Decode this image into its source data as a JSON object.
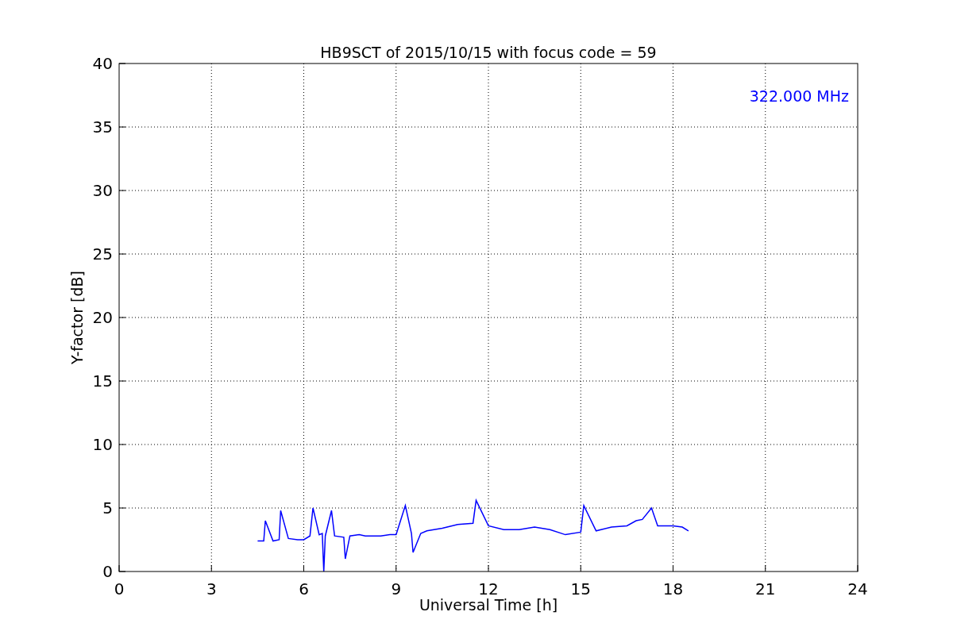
{
  "chart_data": {
    "type": "line",
    "title": "HB9SCT of 2015/10/15 with focus code = 59",
    "xlabel": "Universal Time [h]",
    "ylabel": "Y-factor [dB]",
    "x": [
      4.5,
      4.7,
      4.75,
      5.0,
      5.2,
      5.25,
      5.5,
      5.8,
      6.0,
      6.2,
      6.3,
      6.5,
      6.6,
      6.65,
      6.7,
      6.9,
      7.0,
      7.3,
      7.35,
      7.5,
      7.8,
      8.0,
      8.5,
      8.8,
      9.0,
      9.3,
      9.5,
      9.55,
      9.8,
      10.0,
      10.5,
      11.0,
      11.5,
      11.6,
      12.0,
      12.5,
      13.0,
      13.5,
      14.0,
      14.5,
      15.0,
      15.1,
      15.5,
      16.0,
      16.5,
      16.8,
      17.0,
      17.3,
      17.5,
      18.0,
      18.3,
      18.5
    ],
    "series": [
      {
        "name": "322.000 MHz",
        "color": "#0000ff",
        "values": [
          2.4,
          2.4,
          4.0,
          2.4,
          2.5,
          4.8,
          2.6,
          2.5,
          2.5,
          2.8,
          5.0,
          2.9,
          3.0,
          0.0,
          2.8,
          4.8,
          2.8,
          2.7,
          1.0,
          2.8,
          2.9,
          2.8,
          2.8,
          2.9,
          2.9,
          5.2,
          3.0,
          1.5,
          3.0,
          3.2,
          3.4,
          3.7,
          3.8,
          5.6,
          3.6,
          3.3,
          3.3,
          3.5,
          3.3,
          2.9,
          3.1,
          5.2,
          3.2,
          3.5,
          3.6,
          4.0,
          4.1,
          5.0,
          3.6,
          3.6,
          3.5,
          3.2
        ]
      }
    ],
    "xlim": [
      0,
      24
    ],
    "ylim": [
      0,
      40
    ],
    "grid": true,
    "xticks": [
      0,
      3,
      6,
      9,
      12,
      15,
      18,
      21,
      24
    ],
    "yticks": [
      0,
      5,
      10,
      15,
      20,
      25,
      30,
      35,
      40
    ]
  }
}
